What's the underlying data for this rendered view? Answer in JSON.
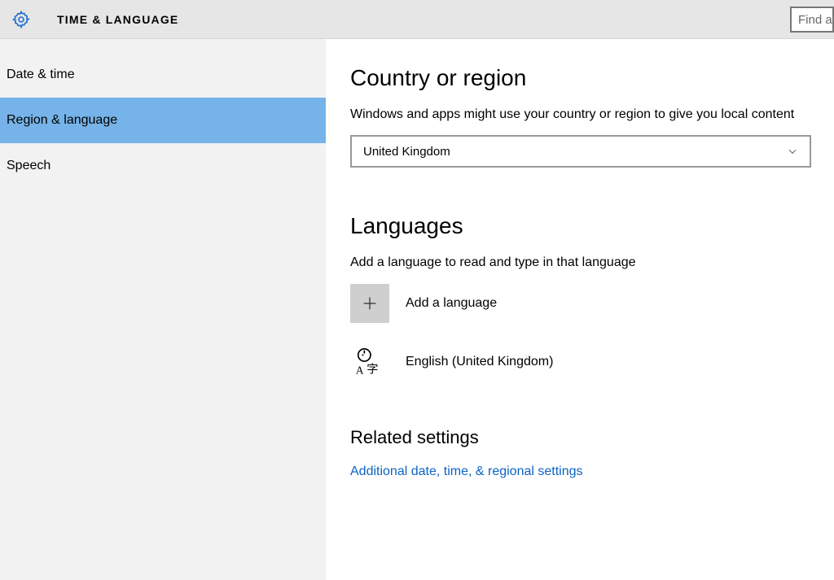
{
  "header": {
    "title": "TIME & LANGUAGE",
    "search_placeholder": "Find a"
  },
  "sidebar": {
    "items": [
      {
        "label": "Date & time",
        "selected": false
      },
      {
        "label": "Region & language",
        "selected": true
      },
      {
        "label": "Speech",
        "selected": false
      }
    ]
  },
  "country_section": {
    "title": "Country or region",
    "desc": "Windows and apps might use your country or region to give you local content",
    "selected": "United Kingdom"
  },
  "languages_section": {
    "title": "Languages",
    "desc": "Add a language to read and type in that language",
    "add_label": "Add a language",
    "items": [
      {
        "name": "English (United Kingdom)"
      }
    ]
  },
  "related_section": {
    "title": "Related settings",
    "link": "Additional date, time, & regional settings"
  }
}
